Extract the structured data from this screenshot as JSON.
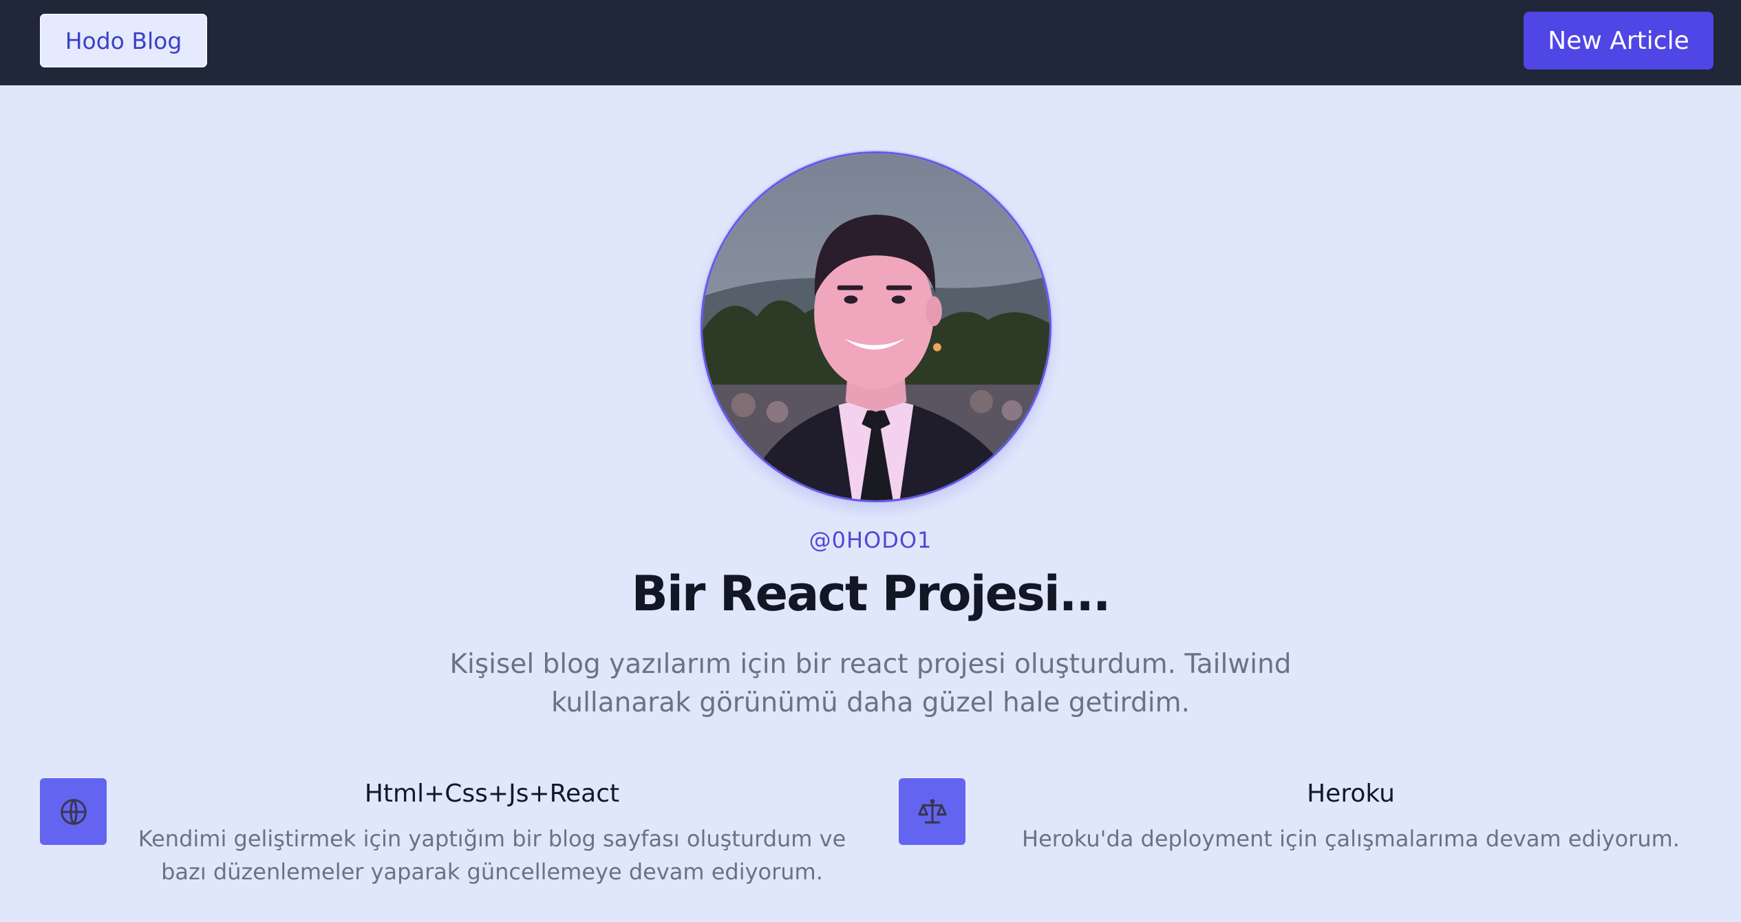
{
  "navbar": {
    "brand_label": "Hodo Blog",
    "new_article_label": "New Article"
  },
  "hero": {
    "username": "@0HODO1",
    "headline": "Bir React Projesi...",
    "intro": "Kişisel blog yazılarım için bir react projesi oluşturdum. Tailwind kullanarak görünümü daha güzel hale getirdim."
  },
  "features": [
    {
      "icon": "globe-icon",
      "title": "Html+Css+Js+React",
      "description": "Kendimi geliştirmek için yaptığım bir blog sayfası oluşturdum ve bazı düzenlemeler yaparak güncellemeye devam ediyorum."
    },
    {
      "icon": "scale-icon",
      "title": "Heroku",
      "description": "Heroku'da deployment için çalışmalarıma devam ediyorum."
    }
  ],
  "colors": {
    "navbar_bg": "#1f2738",
    "page_bg": "#e1e7fb",
    "accent": "#4f46e5",
    "icon_bg": "#6365f1"
  }
}
